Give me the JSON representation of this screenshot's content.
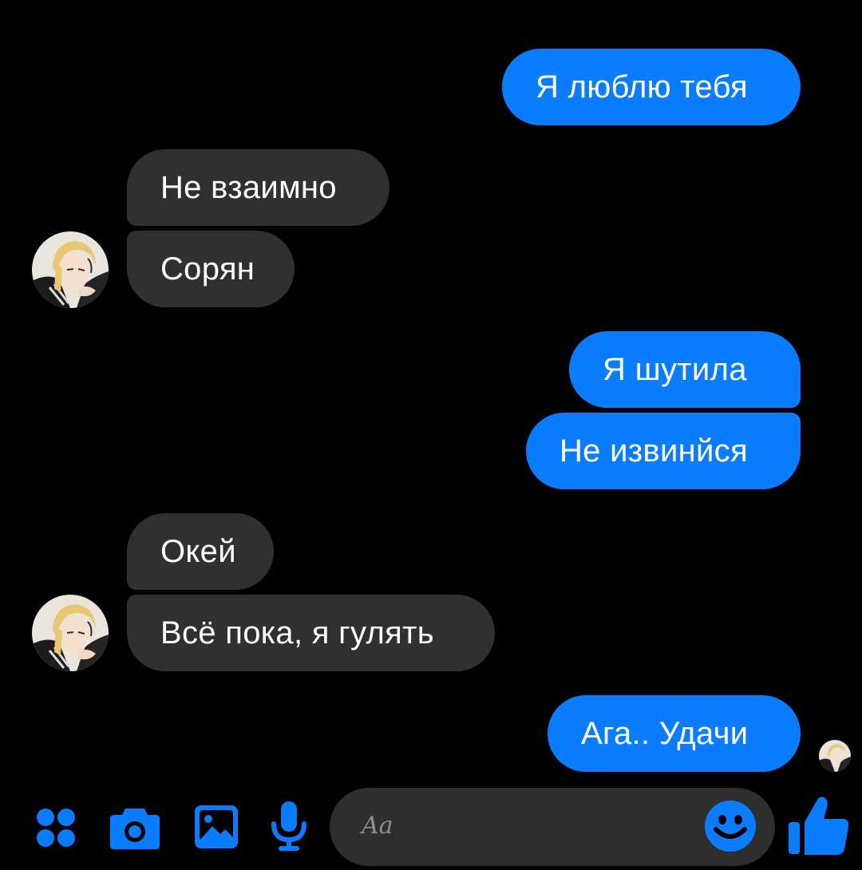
{
  "conversation": {
    "messages": [
      {
        "direction": "outgoing",
        "text": "Я люблю тебя"
      },
      {
        "direction": "incoming",
        "text": "Не взаимно"
      },
      {
        "direction": "incoming",
        "text": "Сорян"
      },
      {
        "direction": "outgoing",
        "text": "Я шутила"
      },
      {
        "direction": "outgoing",
        "text": "Не извинйся"
      },
      {
        "direction": "incoming",
        "text": "Окей"
      },
      {
        "direction": "incoming",
        "text": "Всё пока, я гулять"
      },
      {
        "direction": "outgoing",
        "text": "Ага.. Удачи"
      }
    ]
  },
  "composer": {
    "placeholder": "Aa",
    "icons": [
      "apps-grid-icon",
      "camera-icon",
      "gallery-icon",
      "microphone-icon",
      "emoji-icon",
      "thumbs-up-icon"
    ]
  },
  "colors": {
    "background": "#000000",
    "outgoing_bubble": "#0a7cff",
    "incoming_bubble": "#303030",
    "accent": "#0a7cff",
    "composer_bg": "#2e2e2e"
  }
}
